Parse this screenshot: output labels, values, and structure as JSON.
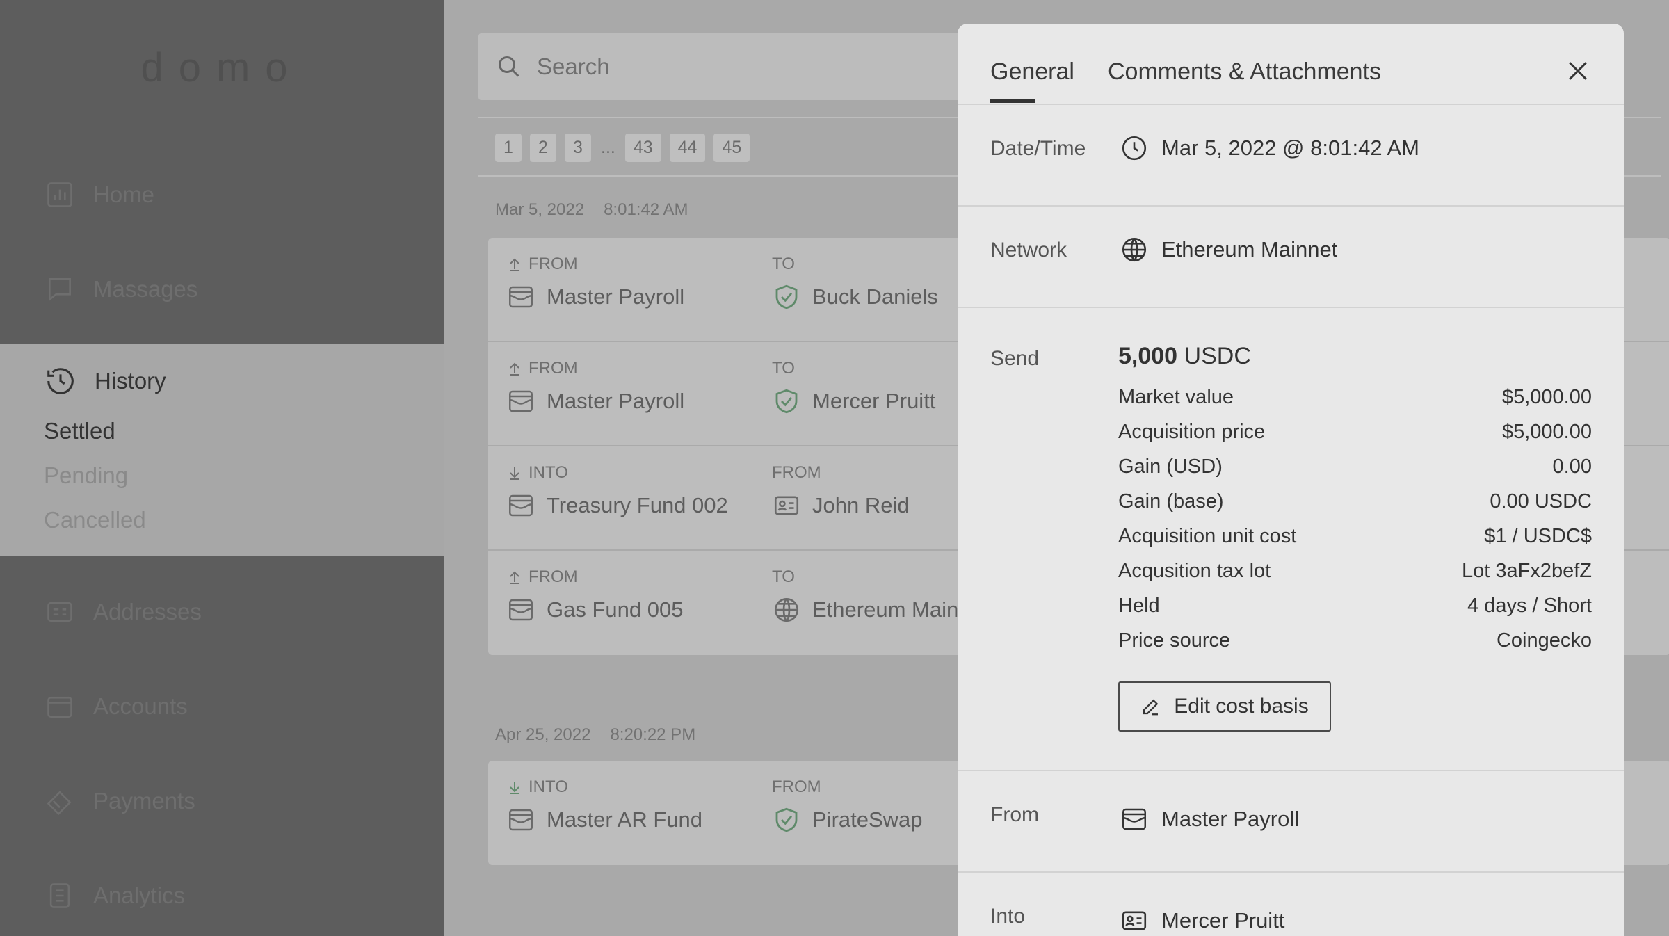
{
  "sidebar": {
    "logo": "domo",
    "items": [
      {
        "label": "Home"
      },
      {
        "label": "Massages"
      },
      {
        "label": "Addresses"
      },
      {
        "label": "Accounts"
      },
      {
        "label": "Payments"
      },
      {
        "label": "Analytics"
      }
    ],
    "history": {
      "label": "History",
      "sub": [
        "Settled",
        "Pending",
        "Cancelled"
      ]
    }
  },
  "main": {
    "search_placeholder": "Search",
    "pager": {
      "pages": [
        "1",
        "2",
        "3",
        "...",
        "43",
        "44",
        "45"
      ]
    },
    "groups": [
      {
        "date": "Mar 5, 2022",
        "time": "8:01:42 AM",
        "rows": [
          {
            "dir": "FROM",
            "account": "Master Payroll",
            "cp_label": "TO",
            "counterparty": "Buck Daniels"
          },
          {
            "dir": "FROM",
            "account": "Master Payroll",
            "cp_label": "TO",
            "counterparty": "Mercer Pruitt"
          },
          {
            "dir": "INTO",
            "account": "Treasury Fund 002",
            "cp_label": "FROM",
            "counterparty": "John Reid"
          },
          {
            "dir": "FROM",
            "account": "Gas Fund 005",
            "cp_label": "TO",
            "counterparty": "Ethereum Mainnet"
          }
        ]
      },
      {
        "date": "Apr 25, 2022",
        "time": "8:20:22 PM",
        "rows": [
          {
            "dir": "INTO",
            "account": "Master AR Fund",
            "cp_label": "FROM",
            "counterparty": "PirateSwap"
          }
        ]
      }
    ]
  },
  "panel": {
    "tabs": [
      "General",
      "Comments & Attachments"
    ],
    "datetime": {
      "label": "Date/Time",
      "value": "Mar 5, 2022 @ 8:01:42 AM"
    },
    "network": {
      "label": "Network",
      "value": "Ethereum Mainnet"
    },
    "send": {
      "label": "Send",
      "amount": "5,000",
      "unit": "USDC",
      "details": [
        {
          "k": "Market value",
          "v": "$5,000.00"
        },
        {
          "k": "Acquisition price",
          "v": "$5,000.00"
        },
        {
          "k": "Gain (USD)",
          "v": "0.00"
        },
        {
          "k": "Gain (base)",
          "v": "0.00 USDC"
        },
        {
          "k": "Acquisition unit cost",
          "v": "$1 / USDC$"
        },
        {
          "k": "Acqusition tax lot",
          "v": "Lot 3aFx2befZ"
        },
        {
          "k": "Held",
          "v": "4 days / Short"
        },
        {
          "k": "Price source",
          "v": "Coingecko"
        }
      ],
      "edit_label": "Edit cost basis"
    },
    "from": {
      "label": "From",
      "value": "Master Payroll"
    },
    "into": {
      "label": "Into",
      "value": "Mercer Pruitt"
    }
  }
}
